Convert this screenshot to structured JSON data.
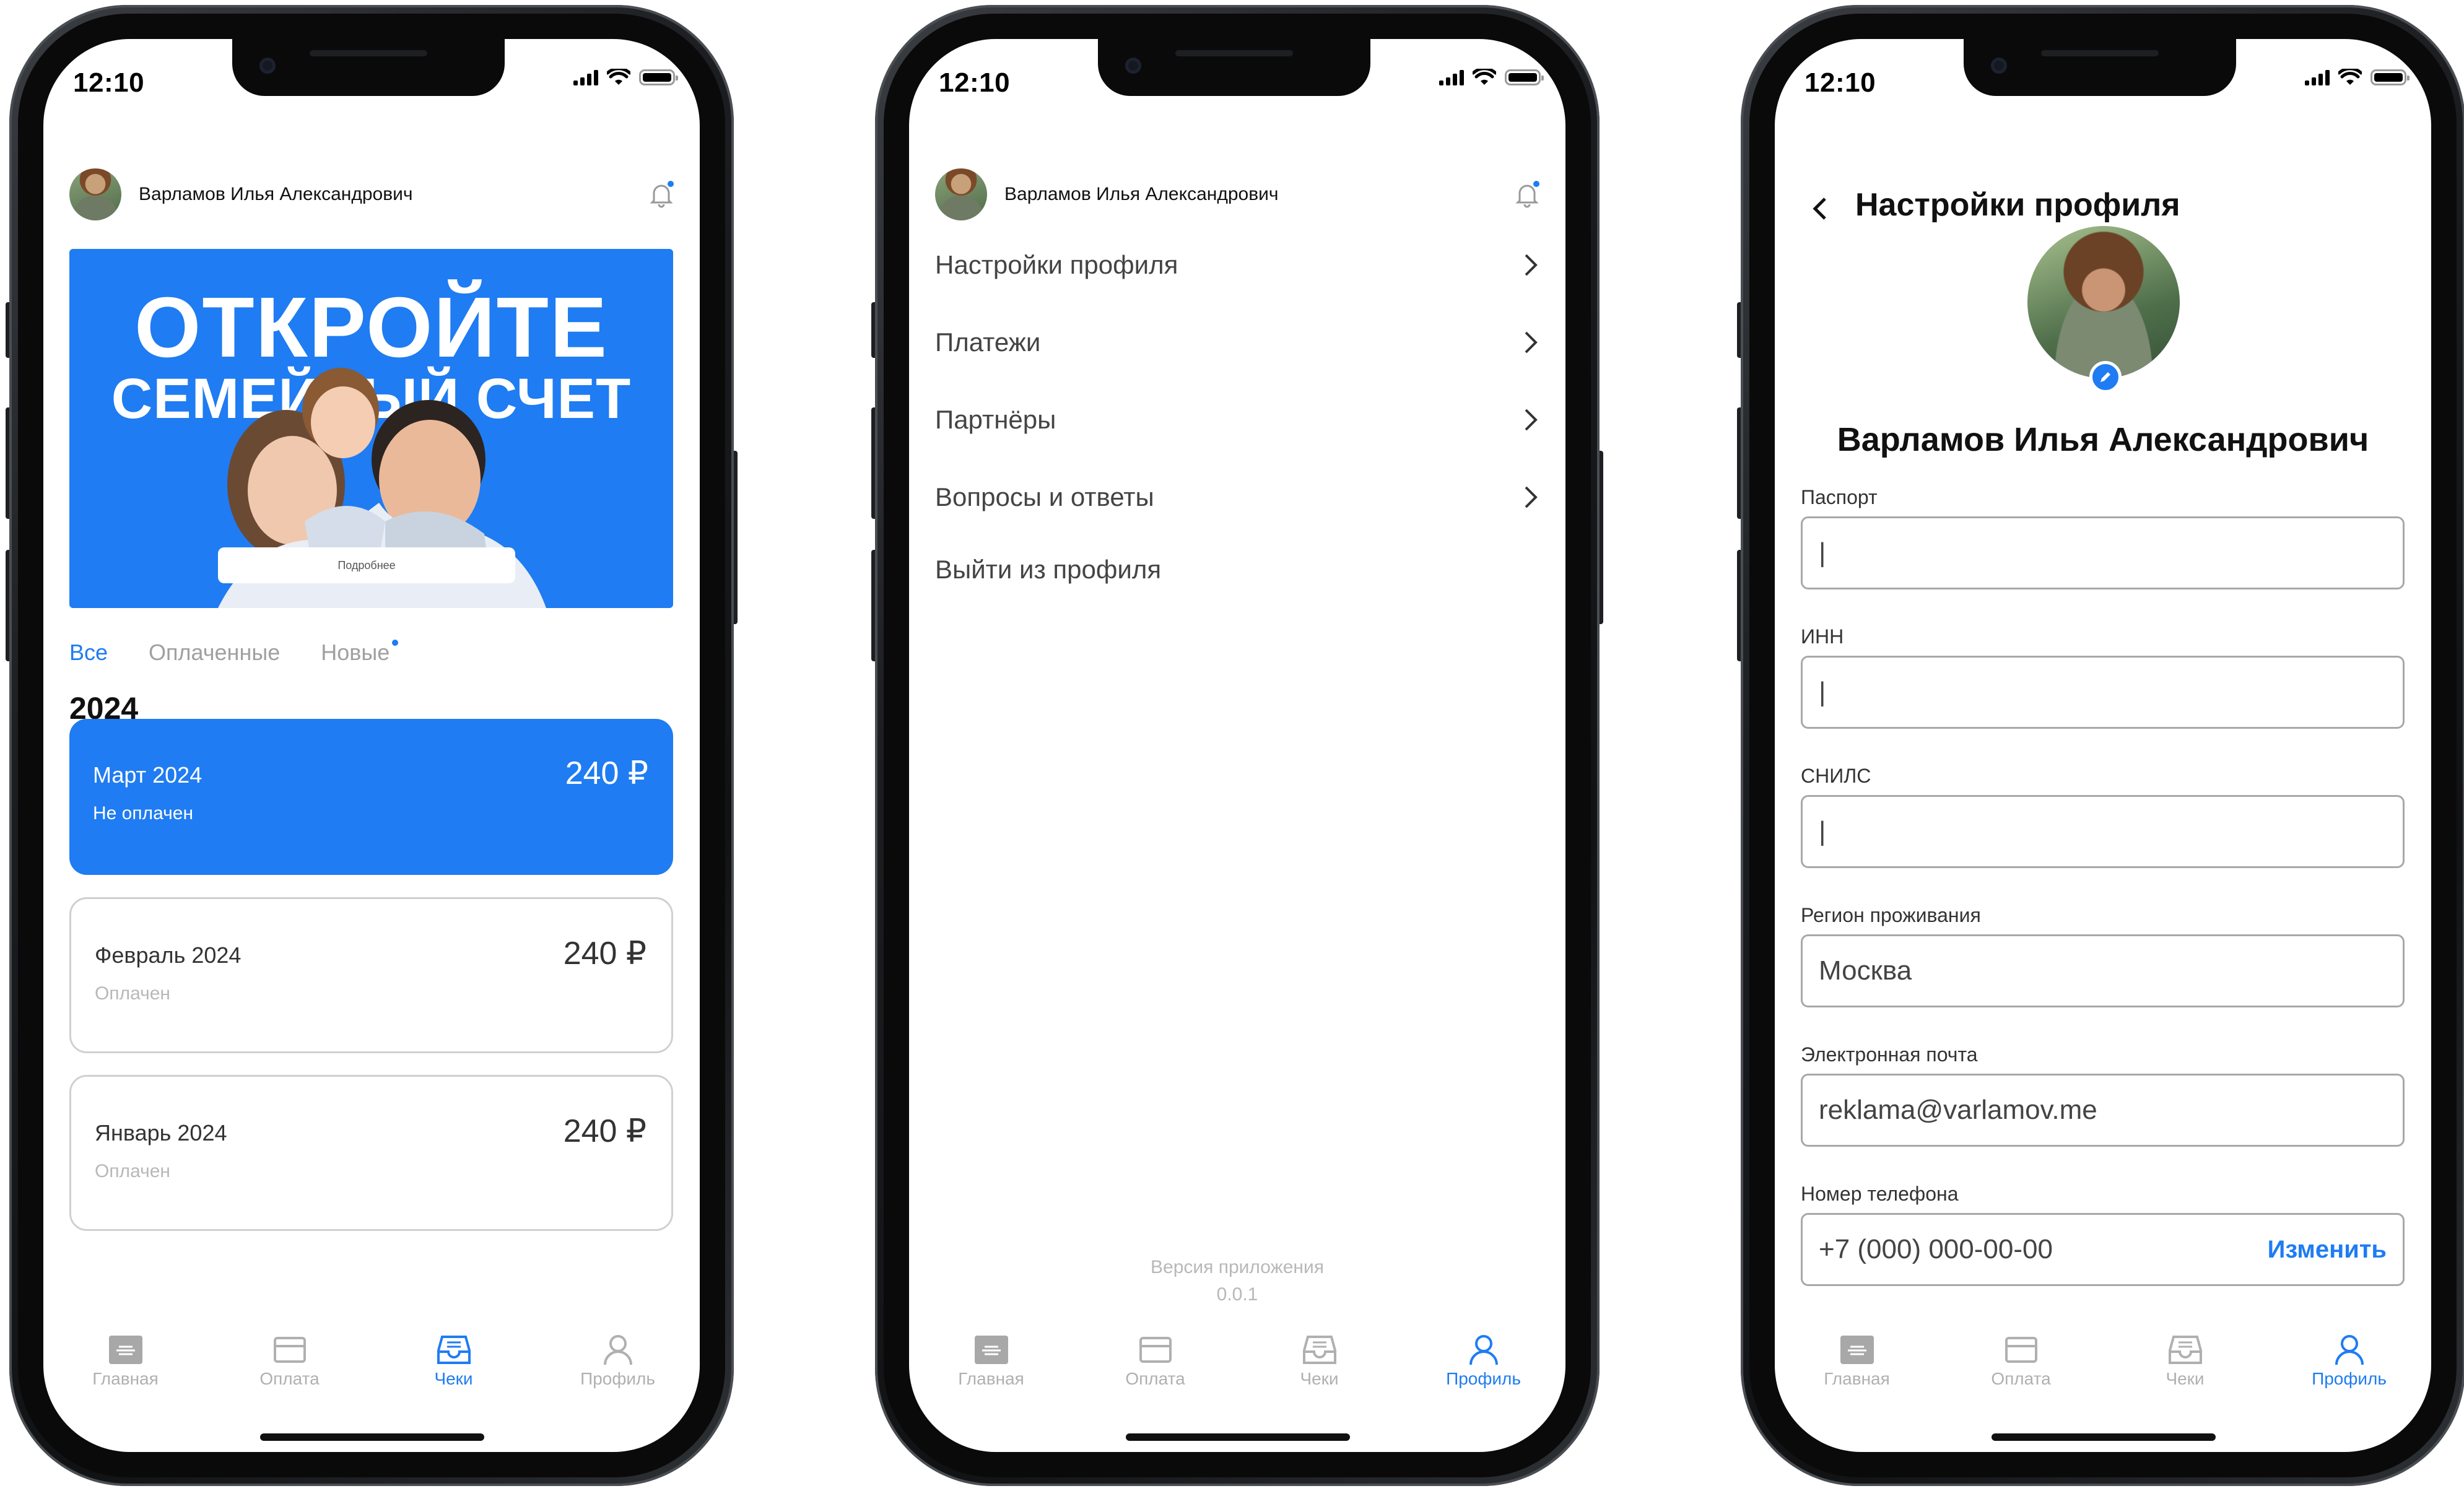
{
  "status": {
    "time": "12:10"
  },
  "user": {
    "name": "Варламов Илья Александрович"
  },
  "screen1": {
    "banner": {
      "line1": "ОТКРОЙТЕ",
      "line2": "СЕМЕЙНЫЙ СЧЕТ",
      "button": "Подробнее"
    },
    "tabs": [
      "Все",
      "Оплаченные",
      "Новые"
    ],
    "year": "2024",
    "cards": [
      {
        "month": "Март 2024",
        "status": "Не оплачен",
        "amount": "240 ₽"
      },
      {
        "month": "Февраль 2024",
        "status": "Оплачен",
        "amount": "240 ₽"
      },
      {
        "month": "Январь 2024",
        "status": "Оплачен",
        "amount": "240 ₽"
      }
    ]
  },
  "screen2": {
    "menu": [
      "Настройки профиля",
      "Платежи",
      "Партнёры",
      "Вопросы и ответы",
      "Выйти из профиля"
    ],
    "version_label": "Версия приложения",
    "version": "0.0.1"
  },
  "screen3": {
    "title": "Настройки профиля",
    "fields": {
      "passport": {
        "label": "Паспорт",
        "value": "|"
      },
      "inn": {
        "label": "ИНН",
        "value": "|"
      },
      "snils": {
        "label": "СНИЛС",
        "value": "|"
      },
      "region": {
        "label": "Регион проживания",
        "value": "Москва"
      },
      "email": {
        "label": "Электронная почта",
        "value": "reklama@varlamov.me"
      },
      "phone": {
        "label": "Номер телефона",
        "value": "+7 (000) 000-00-00",
        "action": "Изменить"
      }
    }
  },
  "nav": {
    "home": "Главная",
    "pay": "Оплата",
    "checks": "Чеки",
    "profile": "Профиль"
  },
  "colors": {
    "accent": "#1f7cf2",
    "muted": "#b0b0b0",
    "border": "#d0d0d0"
  },
  "icons": [
    "signal-icon",
    "wifi-icon",
    "battery-icon",
    "bell-icon",
    "chevron-right-icon",
    "back-arrow-icon",
    "pencil-icon",
    "home-icon",
    "card-icon",
    "receipt-icon",
    "profile-icon"
  ]
}
